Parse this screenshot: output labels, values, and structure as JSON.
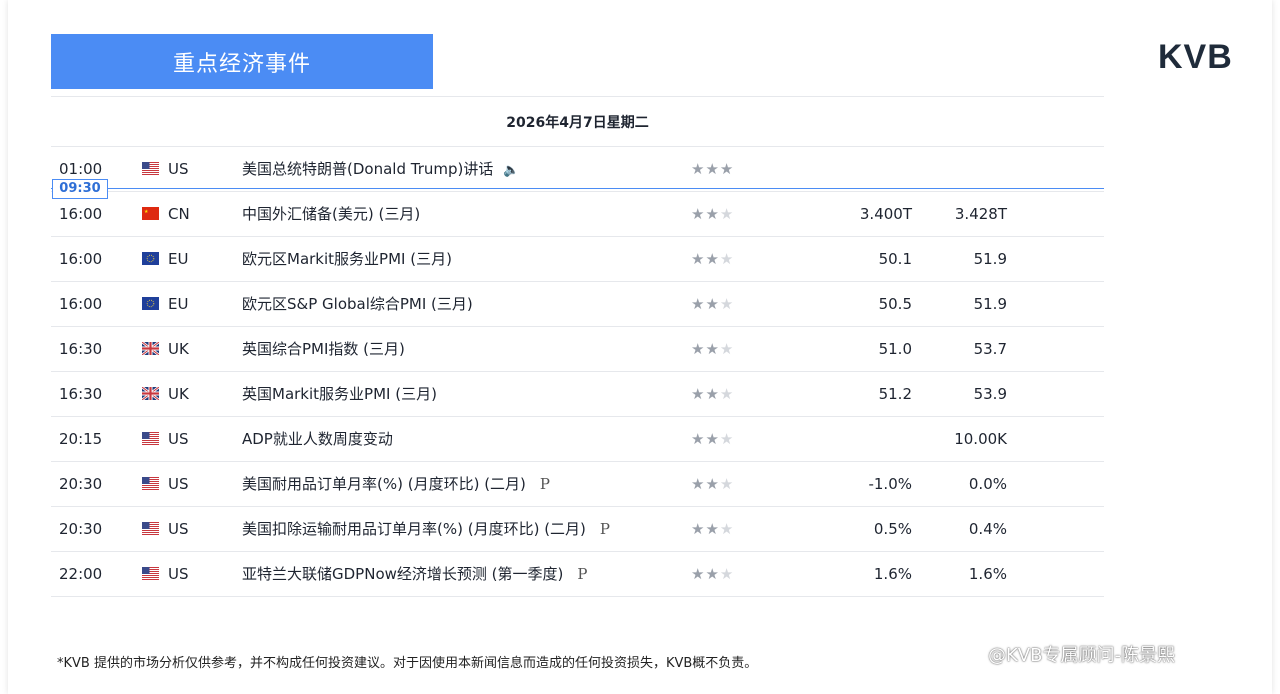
{
  "header": {
    "title": "重点经济事件"
  },
  "logo": {
    "text": "KVB"
  },
  "date": "2026年4月7日星期二",
  "now_marker": "09:30",
  "rows": [
    {
      "time": "01:00",
      "flag": "us",
      "country": "US",
      "event": "美国总统特朗普(Donald Trump)讲话",
      "speaker": true,
      "p": "",
      "importance": 3,
      "previous": "",
      "forecast": ""
    },
    {
      "time": "16:00",
      "flag": "cn",
      "country": "CN",
      "event": "中国外汇储备(美元) (三月)",
      "speaker": false,
      "p": "",
      "importance": 2,
      "previous": "3.400T",
      "forecast": "3.428T"
    },
    {
      "time": "16:00",
      "flag": "eu",
      "country": "EU",
      "event": "欧元区Markit服务业PMI (三月)",
      "speaker": false,
      "p": "",
      "importance": 2,
      "previous": "50.1",
      "forecast": "51.9"
    },
    {
      "time": "16:00",
      "flag": "eu",
      "country": "EU",
      "event": "欧元区S&P Global综合PMI (三月)",
      "speaker": false,
      "p": "",
      "importance": 2,
      "previous": "50.5",
      "forecast": "51.9"
    },
    {
      "time": "16:30",
      "flag": "uk",
      "country": "UK",
      "event": "英国综合PMI指数 (三月)",
      "speaker": false,
      "p": "",
      "importance": 2,
      "previous": "51.0",
      "forecast": "53.7"
    },
    {
      "time": "16:30",
      "flag": "uk",
      "country": "UK",
      "event": "英国Markit服务业PMI (三月)",
      "speaker": false,
      "p": "",
      "importance": 2,
      "previous": "51.2",
      "forecast": "53.9"
    },
    {
      "time": "20:15",
      "flag": "us",
      "country": "US",
      "event": "ADP就业人数周度变动",
      "speaker": false,
      "p": "",
      "importance": 2,
      "previous": "",
      "forecast": "10.00K"
    },
    {
      "time": "20:30",
      "flag": "us",
      "country": "US",
      "event": "美国耐用品订单月率(%) (月度环比) (二月)",
      "speaker": false,
      "p": "P",
      "importance": 2,
      "previous": "-1.0%",
      "forecast": "0.0%"
    },
    {
      "time": "20:30",
      "flag": "us",
      "country": "US",
      "event": "美国扣除运输耐用品订单月率(%) (月度环比) (二月)",
      "speaker": false,
      "p": "P",
      "importance": 2,
      "previous": "0.5%",
      "forecast": "0.4%"
    },
    {
      "time": "22:00",
      "flag": "us",
      "country": "US",
      "event": "亚特兰大联储GDPNow经济增长预测 (第一季度)",
      "speaker": false,
      "p": "P",
      "importance": 2,
      "previous": "1.6%",
      "forecast": "1.6%"
    }
  ],
  "disclaimer": "*KVB 提供的市场分析仅供参考，并不构成任何投资建议。对于因使用本新闻信息而造成的任何投资损失，KVB概不负责。",
  "watermark": "@KVB专属顾问-陈景熙",
  "colors": {
    "accent": "#4b8cf4",
    "star_on": "#9aa0aa",
    "star_off": "#d5d8dd",
    "logo": "#1f2b3a"
  }
}
